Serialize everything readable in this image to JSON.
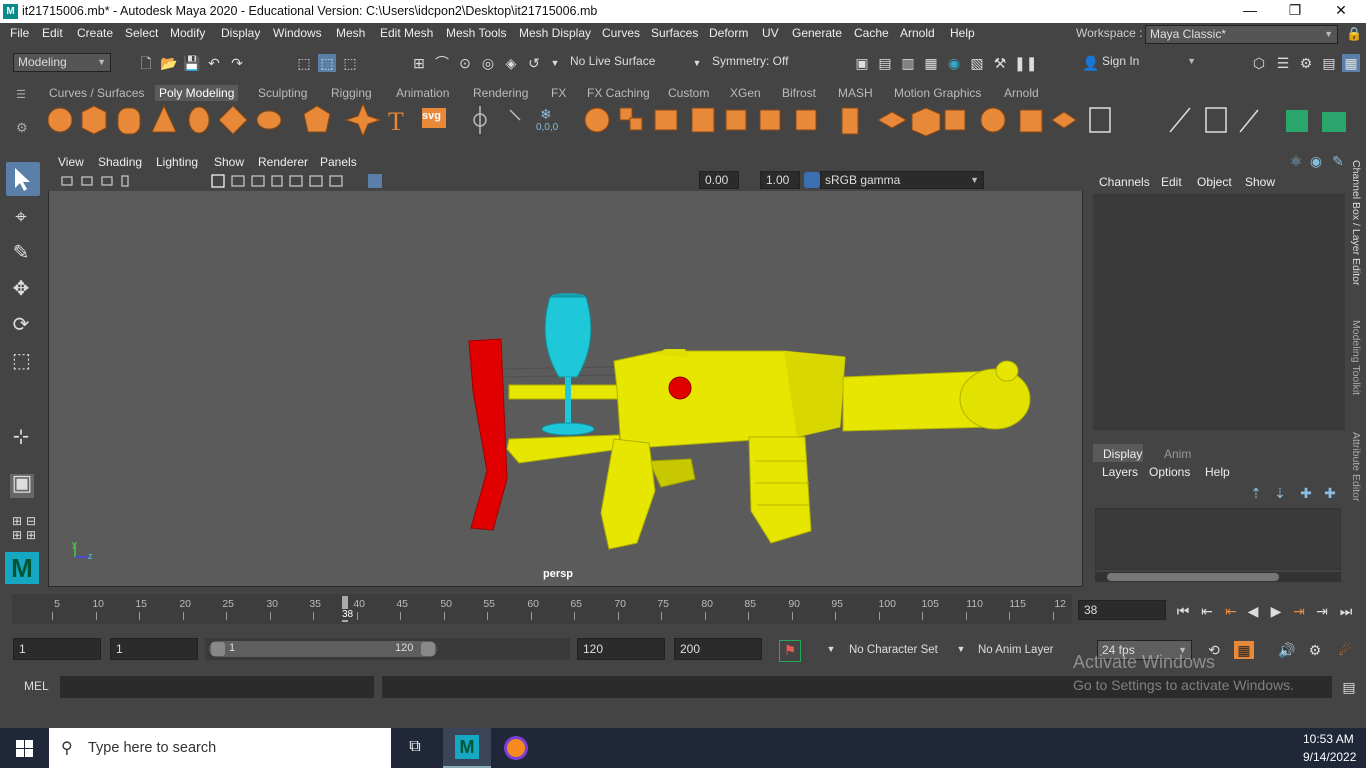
{
  "title_bar": {
    "logo_letter": "M",
    "title": "it21715006.mb* - Autodesk Maya 2020 - Educational Version: C:\\Users\\idcpon2\\Desktop\\it21715006.mb",
    "minimize": "—",
    "restore": "❐",
    "close": "✕"
  },
  "menus": [
    "File",
    "Edit",
    "Create",
    "Select",
    "Modify",
    "Display",
    "Windows",
    "Mesh",
    "Edit Mesh",
    "Mesh Tools",
    "Mesh Display",
    "Curves",
    "Surfaces",
    "Deform",
    "UV",
    "Generate",
    "Cache",
    "Arnold",
    "Help"
  ],
  "workspace": {
    "label": "Workspace :",
    "value": "Maya Classic*"
  },
  "status_line": {
    "mode": "Modeling",
    "live_surface": "No Live Surface",
    "symmetry": "Symmetry: Off",
    "sign_in": "Sign In"
  },
  "shelf_tabs": [
    "Curves / Surfaces",
    "Poly Modeling",
    "Sculpting",
    "Rigging",
    "Animation",
    "Rendering",
    "FX",
    "FX Caching",
    "Custom",
    "XGen",
    "Bifrost",
    "MASH",
    "Motion Graphics",
    "Arnold"
  ],
  "active_shelf_tab": "Poly Modeling",
  "shelf_svg_label": "svg",
  "shelf_coords_label": "0,0,0",
  "viewport": {
    "menus": [
      "View",
      "Shading",
      "Lighting",
      "Show",
      "Renderer",
      "Panels"
    ],
    "exposure": "0.00",
    "gamma": "1.00",
    "color_space": "sRGB gamma",
    "camera_label": "persp",
    "axis_y": "y",
    "axis_z": "z"
  },
  "channel_box": {
    "menus": [
      "Channels",
      "Edit",
      "Object",
      "Show"
    ]
  },
  "layer_editor": {
    "tabs": [
      "Display",
      "Anim"
    ],
    "menus": [
      "Layers",
      "Options",
      "Help"
    ]
  },
  "side_tabs": [
    "Channel Box / Layer Editor",
    "Modeling Toolkit",
    "Attribute Editor"
  ],
  "time_slider": {
    "ticks": [
      "5",
      "10",
      "15",
      "20",
      "25",
      "30",
      "35",
      "40",
      "45",
      "50",
      "55",
      "60",
      "65",
      "70",
      "75",
      "80",
      "85",
      "90",
      "95",
      "100",
      "105",
      "110",
      "115",
      "12"
    ],
    "current_frame": "38",
    "current_frame_field": "38"
  },
  "range_bar": {
    "start": "1",
    "playback_start": "1",
    "slider_start": "1",
    "slider_end": "120",
    "playback_end": "120",
    "end": "200",
    "character_set": "No Character Set",
    "anim_layer": "No Anim Layer",
    "fps": "24 fps"
  },
  "command_line": {
    "label": "MEL"
  },
  "watermark": {
    "line1": "Activate Windows",
    "line2": "Go to Settings to activate Windows."
  },
  "taskbar": {
    "search_placeholder": "Type here to search",
    "time": "10:53 AM",
    "date": "9/14/2022"
  },
  "colors": {
    "maya_bg": "#444444",
    "viewport_bg": "#5b5b5b",
    "shelf_orange": "#e8893a",
    "gun_yellow": "#e6e600",
    "stock_red": "#e00000",
    "glass_cyan": "#1ec8d8",
    "taskbar": "#1f2738"
  }
}
